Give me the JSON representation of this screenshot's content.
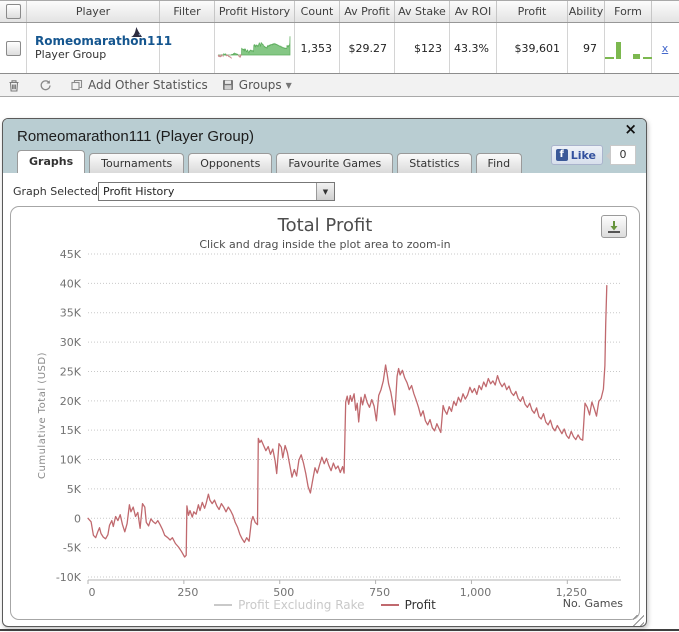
{
  "table": {
    "header": {
      "columns": [
        "",
        "Player",
        "Filter",
        "Profit History",
        "Count",
        "Av Profit",
        "Av Stake",
        "Av ROI",
        "Profit",
        "Ability",
        "Form",
        ""
      ]
    },
    "row": {
      "player_name": "Romeomarathon111",
      "player_type": "Player Group",
      "count": "1,353",
      "av_profit": "$29.27",
      "av_stake": "$123",
      "av_roi": "43.3%",
      "profit": "$39,601",
      "ability": "97",
      "remove_label": "x",
      "form_bars": [
        [
          9,
          2
        ],
        [
          5,
          17
        ],
        [
          7,
          5
        ],
        [
          9,
          2
        ]
      ],
      "spark_colors": {
        "positive": "#85c785",
        "positive_edge": "#5fae5f",
        "negative": "#c9898d"
      }
    },
    "toolbar": {
      "add_other_statistics": "Add Other Statistics",
      "groups": "Groups"
    }
  },
  "dialog": {
    "title": "Romeomarathon111 (Player Group)",
    "tabs": [
      {
        "label": "Graphs",
        "active": true
      },
      {
        "label": "Tournaments",
        "active": false
      },
      {
        "label": "Opponents",
        "active": false
      },
      {
        "label": "Favourite Games",
        "active": false
      },
      {
        "label": "Statistics",
        "active": false
      },
      {
        "label": "Find",
        "active": false
      }
    ],
    "like": {
      "label": "Like",
      "count": "0"
    },
    "graph_selected_label": "Graph Selected:",
    "graph_selected_value": "Profit History"
  },
  "icons": {
    "close": "×",
    "dropdown_arrow": "▼",
    "groups_caret": "▼",
    "facebook_f": "f"
  },
  "chart_data": {
    "type": "line",
    "title": "Total Profit",
    "subtitle": "Click and drag inside the plot area to zoom-in",
    "ylabel": "Cumulative Total (USD)",
    "xlabel": "No. Games",
    "xlim": [
      0,
      1390
    ],
    "ylim": [
      -10000,
      45000
    ],
    "grid": "dotted",
    "legend_position": "bottom",
    "yticks": [
      {
        "v": 45000,
        "label": "45K"
      },
      {
        "v": 40000,
        "label": "40K"
      },
      {
        "v": 35000,
        "label": "35K"
      },
      {
        "v": 30000,
        "label": "30K"
      },
      {
        "v": 25000,
        "label": "25K"
      },
      {
        "v": 20000,
        "label": "20K"
      },
      {
        "v": 15000,
        "label": "15K"
      },
      {
        "v": 10000,
        "label": "10K"
      },
      {
        "v": 5000,
        "label": "5K"
      },
      {
        "v": 0,
        "label": "0"
      },
      {
        "v": -5000,
        "label": "-5K"
      },
      {
        "v": -10000,
        "label": "-10K"
      }
    ],
    "xticks": [
      {
        "v": 0,
        "label": "0"
      },
      {
        "v": 250,
        "label": "250"
      },
      {
        "v": 500,
        "label": "500"
      },
      {
        "v": 750,
        "label": "750"
      },
      {
        "v": 1000,
        "label": "1,000"
      },
      {
        "v": 1250,
        "label": "1,250"
      }
    ],
    "series": [
      {
        "name": "Profit Excluding Rake",
        "color": "#c9c9c9",
        "label_color": "#c9c9c9",
        "visible": false,
        "points": []
      },
      {
        "name": "Profit",
        "color": "#c0696e",
        "label_color": "#333333",
        "visible": true,
        "points": [
          [
            0,
            0
          ],
          [
            8,
            -600
          ],
          [
            14,
            -2900
          ],
          [
            20,
            -3300
          ],
          [
            26,
            -2200
          ],
          [
            30,
            -1600
          ],
          [
            34,
            -2600
          ],
          [
            40,
            -3200
          ],
          [
            46,
            -3500
          ],
          [
            52,
            -2800
          ],
          [
            56,
            -1200
          ],
          [
            62,
            -400
          ],
          [
            66,
            -1400
          ],
          [
            72,
            300
          ],
          [
            78,
            -400
          ],
          [
            84,
            600
          ],
          [
            90,
            -1100
          ],
          [
            96,
            -2300
          ],
          [
            102,
            -900
          ],
          [
            108,
            2300
          ],
          [
            112,
            1100
          ],
          [
            118,
            1900
          ],
          [
            124,
            300
          ],
          [
            130,
            1000
          ],
          [
            136,
            -1700
          ],
          [
            142,
            2500
          ],
          [
            148,
            1900
          ],
          [
            152,
            -700
          ],
          [
            158,
            -1300
          ],
          [
            164,
            -100
          ],
          [
            170,
            -600
          ],
          [
            176,
            -900
          ],
          [
            182,
            -400
          ],
          [
            188,
            -1100
          ],
          [
            194,
            -1900
          ],
          [
            200,
            -2900
          ],
          [
            208,
            -3300
          ],
          [
            214,
            -3700
          ],
          [
            220,
            -3300
          ],
          [
            228,
            -4300
          ],
          [
            236,
            -4900
          ],
          [
            244,
            -5700
          ],
          [
            252,
            -6600
          ],
          [
            256,
            -6300
          ],
          [
            258,
            2100
          ],
          [
            262,
            500
          ],
          [
            266,
            1300
          ],
          [
            272,
            200
          ],
          [
            276,
            1100
          ],
          [
            282,
            700
          ],
          [
            288,
            2300
          ],
          [
            292,
            1300
          ],
          [
            298,
            2700
          ],
          [
            304,
            1700
          ],
          [
            308,
            2500
          ],
          [
            314,
            4100
          ],
          [
            318,
            3100
          ],
          [
            324,
            2500
          ],
          [
            330,
            3100
          ],
          [
            336,
            2100
          ],
          [
            342,
            1500
          ],
          [
            348,
            2500
          ],
          [
            354,
            1900
          ],
          [
            360,
            1100
          ],
          [
            366,
            1900
          ],
          [
            372,
            1300
          ],
          [
            378,
            500
          ],
          [
            384,
            -700
          ],
          [
            390,
            -1500
          ],
          [
            396,
            -2700
          ],
          [
            402,
            -3500
          ],
          [
            408,
            -4100
          ],
          [
            414,
            -3300
          ],
          [
            420,
            -3900
          ],
          [
            426,
            -500
          ],
          [
            430,
            300
          ],
          [
            436,
            -700
          ],
          [
            442,
            -1100
          ],
          [
            444,
            13600
          ],
          [
            448,
            12900
          ],
          [
            452,
            13300
          ],
          [
            458,
            12400
          ],
          [
            464,
            11500
          ],
          [
            470,
            12200
          ],
          [
            476,
            10900
          ],
          [
            482,
            11800
          ],
          [
            488,
            9800
          ],
          [
            492,
            7600
          ],
          [
            498,
            12700
          ],
          [
            504,
            12100
          ],
          [
            508,
            10300
          ],
          [
            514,
            12400
          ],
          [
            520,
            11200
          ],
          [
            526,
            9100
          ],
          [
            532,
            7000
          ],
          [
            538,
            8300
          ],
          [
            544,
            7200
          ],
          [
            550,
            9900
          ],
          [
            556,
            10800
          ],
          [
            562,
            9400
          ],
          [
            568,
            7600
          ],
          [
            574,
            5400
          ],
          [
            580,
            4300
          ],
          [
            586,
            6500
          ],
          [
            592,
            8600
          ],
          [
            598,
            7700
          ],
          [
            604,
            9100
          ],
          [
            610,
            10400
          ],
          [
            616,
            9300
          ],
          [
            622,
            10200
          ],
          [
            628,
            9000
          ],
          [
            634,
            8100
          ],
          [
            640,
            9400
          ],
          [
            646,
            8400
          ],
          [
            652,
            8900
          ],
          [
            658,
            7800
          ],
          [
            664,
            8800
          ],
          [
            668,
            7700
          ],
          [
            672,
            19800
          ],
          [
            676,
            20800
          ],
          [
            680,
            19400
          ],
          [
            684,
            20900
          ],
          [
            688,
            19900
          ],
          [
            694,
            21200
          ],
          [
            698,
            18400
          ],
          [
            702,
            19600
          ],
          [
            706,
            16400
          ],
          [
            712,
            20600
          ],
          [
            716,
            19300
          ],
          [
            722,
            21100
          ],
          [
            728,
            19700
          ],
          [
            734,
            18900
          ],
          [
            740,
            20200
          ],
          [
            746,
            19100
          ],
          [
            752,
            16600
          ],
          [
            758,
            20900
          ],
          [
            764,
            21900
          ],
          [
            770,
            23400
          ],
          [
            776,
            26100
          ],
          [
            780,
            24600
          ],
          [
            784,
            22900
          ],
          [
            790,
            21400
          ],
          [
            796,
            19100
          ],
          [
            800,
            17600
          ],
          [
            806,
            24200
          ],
          [
            810,
            25500
          ],
          [
            814,
            24400
          ],
          [
            820,
            25200
          ],
          [
            826,
            23900
          ],
          [
            832,
            23100
          ],
          [
            838,
            21900
          ],
          [
            844,
            22600
          ],
          [
            850,
            21200
          ],
          [
            856,
            20100
          ],
          [
            862,
            18900
          ],
          [
            868,
            17400
          ],
          [
            874,
            18300
          ],
          [
            880,
            16600
          ],
          [
            886,
            15900
          ],
          [
            892,
            16800
          ],
          [
            898,
            15400
          ],
          [
            904,
            14900
          ],
          [
            910,
            16100
          ],
          [
            916,
            15200
          ],
          [
            920,
            14600
          ],
          [
            926,
            19200
          ],
          [
            930,
            18400
          ],
          [
            936,
            17700
          ],
          [
            942,
            19000
          ],
          [
            948,
            18200
          ],
          [
            954,
            19900
          ],
          [
            960,
            19200
          ],
          [
            966,
            20600
          ],
          [
            972,
            19800
          ],
          [
            978,
            21200
          ],
          [
            984,
            20300
          ],
          [
            990,
            21000
          ],
          [
            996,
            22300
          ],
          [
            1002,
            21400
          ],
          [
            1008,
            22100
          ],
          [
            1014,
            21100
          ],
          [
            1020,
            22600
          ],
          [
            1026,
            21900
          ],
          [
            1032,
            23200
          ],
          [
            1038,
            22400
          ],
          [
            1044,
            23800
          ],
          [
            1050,
            22900
          ],
          [
            1056,
            23400
          ],
          [
            1062,
            22700
          ],
          [
            1068,
            24300
          ],
          [
            1074,
            23100
          ],
          [
            1080,
            22400
          ],
          [
            1086,
            23000
          ],
          [
            1092,
            21900
          ],
          [
            1098,
            22500
          ],
          [
            1104,
            21400
          ],
          [
            1110,
            20900
          ],
          [
            1116,
            21600
          ],
          [
            1122,
            20400
          ],
          [
            1128,
            19900
          ],
          [
            1134,
            20700
          ],
          [
            1140,
            19400
          ],
          [
            1146,
            18900
          ],
          [
            1152,
            19600
          ],
          [
            1158,
            18400
          ],
          [
            1164,
            17900
          ],
          [
            1170,
            18800
          ],
          [
            1176,
            17300
          ],
          [
            1182,
            16900
          ],
          [
            1188,
            17800
          ],
          [
            1194,
            16400
          ],
          [
            1200,
            15900
          ],
          [
            1206,
            16700
          ],
          [
            1212,
            15400
          ],
          [
            1218,
            14900
          ],
          [
            1224,
            15800
          ],
          [
            1230,
            15100
          ],
          [
            1236,
            14400
          ],
          [
            1242,
            15200
          ],
          [
            1248,
            14100
          ],
          [
            1254,
            13600
          ],
          [
            1260,
            14800
          ],
          [
            1266,
            13900
          ],
          [
            1272,
            13400
          ],
          [
            1278,
            14200
          ],
          [
            1284,
            13500
          ],
          [
            1290,
            13300
          ],
          [
            1296,
            19600
          ],
          [
            1302,
            18900
          ],
          [
            1308,
            17600
          ],
          [
            1314,
            19800
          ],
          [
            1320,
            18700
          ],
          [
            1326,
            17400
          ],
          [
            1332,
            19900
          ],
          [
            1338,
            20400
          ],
          [
            1344,
            22000
          ],
          [
            1348,
            26000
          ],
          [
            1350,
            33000
          ],
          [
            1353,
            39600
          ]
        ]
      }
    ]
  }
}
